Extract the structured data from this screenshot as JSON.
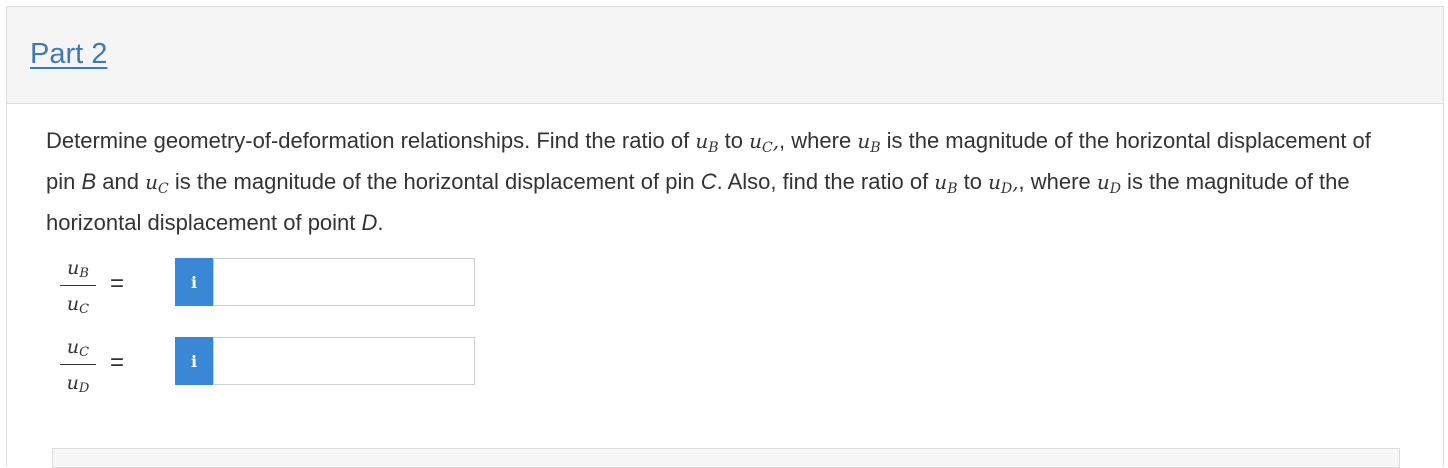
{
  "header": {
    "part_label": "Part 2"
  },
  "question": {
    "t1": "Determine geometry-of-deformation relationships. Find the ratio of ",
    "t2": " to ",
    "t3": ", where ",
    "t4": " is the magnitude of the horizontal displacement of pin ",
    "pinB": "B",
    "t5": " and ",
    "t6": " is the magnitude of the horizontal displacement of pin ",
    "pinC": "C",
    "t7": ". Also, find the ratio of ",
    "t8": " to ",
    "t9": ", where ",
    "t10": " is the magnitude of the horizontal displacement of point ",
    "pointD": "D",
    "t11": "."
  },
  "math": {
    "u": "u",
    "B": "B",
    "C": "C",
    "D": "D",
    "comma": ","
  },
  "answers": [
    {
      "num_sub": "B",
      "den_sub": "C",
      "equals": "=",
      "info": "i",
      "value": ""
    },
    {
      "num_sub": "C",
      "den_sub": "D",
      "equals": "=",
      "info": "i",
      "value": ""
    }
  ],
  "colors": {
    "link": "#3a7ab8",
    "info_button": "#3a87d6"
  },
  "icons": {
    "info": "info-icon"
  }
}
